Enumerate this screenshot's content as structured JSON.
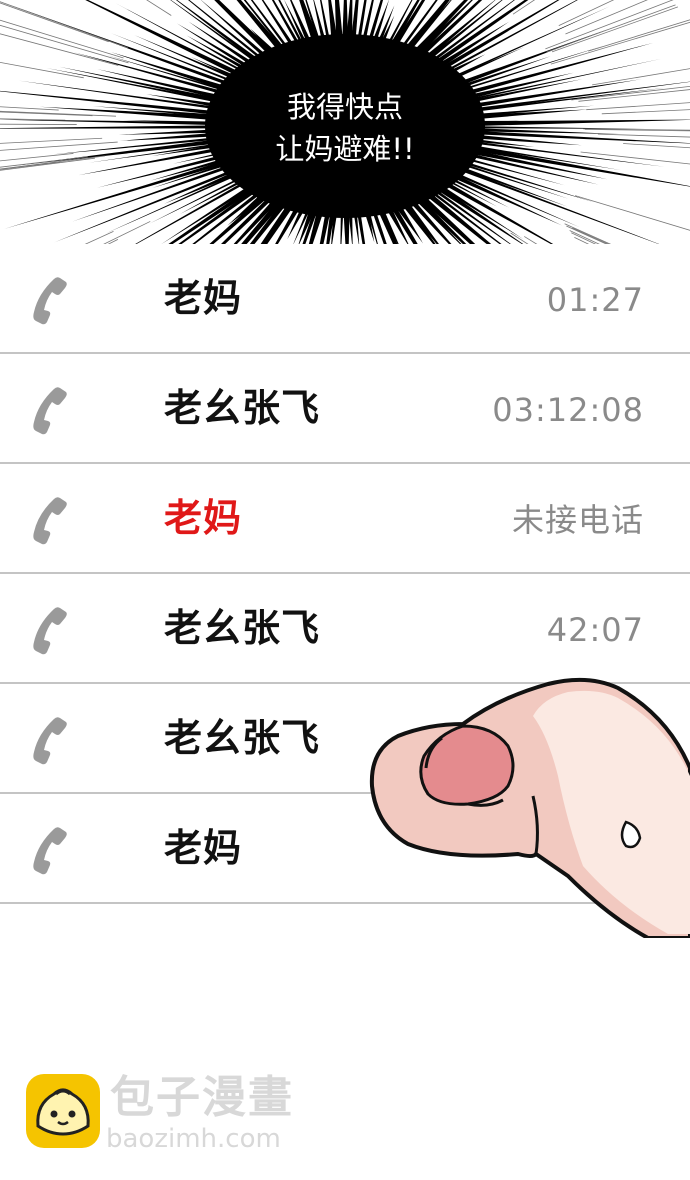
{
  "caption": {
    "line1": "我得快点",
    "line2": "让妈避难!!"
  },
  "calls": [
    {
      "name": "老妈",
      "meta": "01:27",
      "missed": false
    },
    {
      "name": "老幺张飞",
      "meta": "03:12:08",
      "missed": false
    },
    {
      "name": "老妈",
      "meta": "未接电话",
      "missed": true
    },
    {
      "name": "老幺张飞",
      "meta": "42:07",
      "missed": false
    },
    {
      "name": "老幺张飞",
      "meta": "",
      "missed": false
    },
    {
      "name": "老妈",
      "meta": "",
      "missed": false
    }
  ],
  "watermark": {
    "title": "包子漫畫",
    "url": "baozimh.com"
  },
  "icons": {
    "call": "phone-handset-icon",
    "logo": "bun-mascot-icon"
  },
  "colors": {
    "missed": "#e01818",
    "meta": "#8a8a8a",
    "divider": "#c4c4c4",
    "logo": "#f5c400"
  }
}
